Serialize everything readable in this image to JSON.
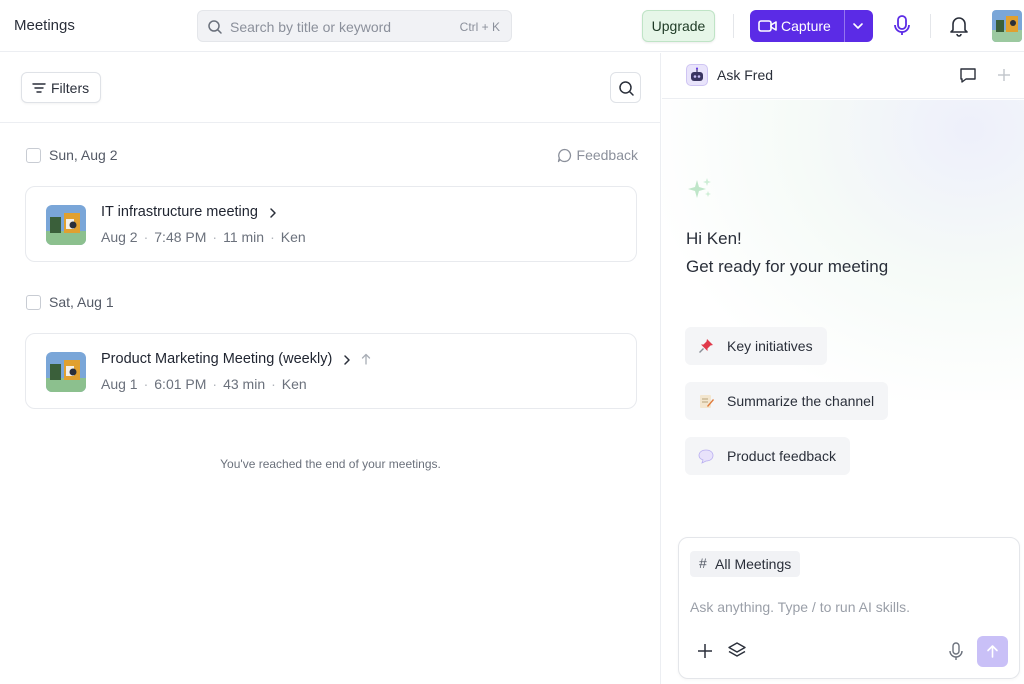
{
  "header": {
    "title": "Meetings",
    "search_placeholder": "Search by title or keyword",
    "search_shortcut": "Ctrl + K",
    "upgrade_label": "Upgrade",
    "capture_label": "Capture"
  },
  "list": {
    "filters_label": "Filters",
    "feedback_label": "Feedback",
    "groups": [
      {
        "date": "Sun, Aug 2",
        "meetings": [
          {
            "title": "IT infrastructure meeting",
            "date": "Aug 2",
            "time": "7:48 PM",
            "duration": "11 min",
            "owner": "Ken"
          }
        ]
      },
      {
        "date": "Sat, Aug 1",
        "meetings": [
          {
            "title": "Product Marketing Meeting (weekly)",
            "date": "Aug 1",
            "time": "6:01 PM",
            "duration": "43 min",
            "owner": "Ken"
          }
        ]
      }
    ],
    "end_message": "You've reached the end of your meetings."
  },
  "assistant": {
    "name": "Ask Fred",
    "greeting_line1": "Hi Ken!",
    "greeting_line2": "Get ready for your meeting",
    "suggestions": [
      {
        "label": "Key initiatives",
        "icon": "pushpin-icon"
      },
      {
        "label": "Summarize the channel",
        "icon": "memo-icon"
      },
      {
        "label": "Product feedback",
        "icon": "speech-bubble-icon"
      }
    ],
    "scope_label": "All Meetings",
    "input_placeholder": "Ask anything. Type / to run AI skills."
  },
  "colors": {
    "brand_purple": "#5b2be6",
    "upgrade_bg": "#e6f6e8",
    "send_disabled": "#c9c0f7"
  }
}
